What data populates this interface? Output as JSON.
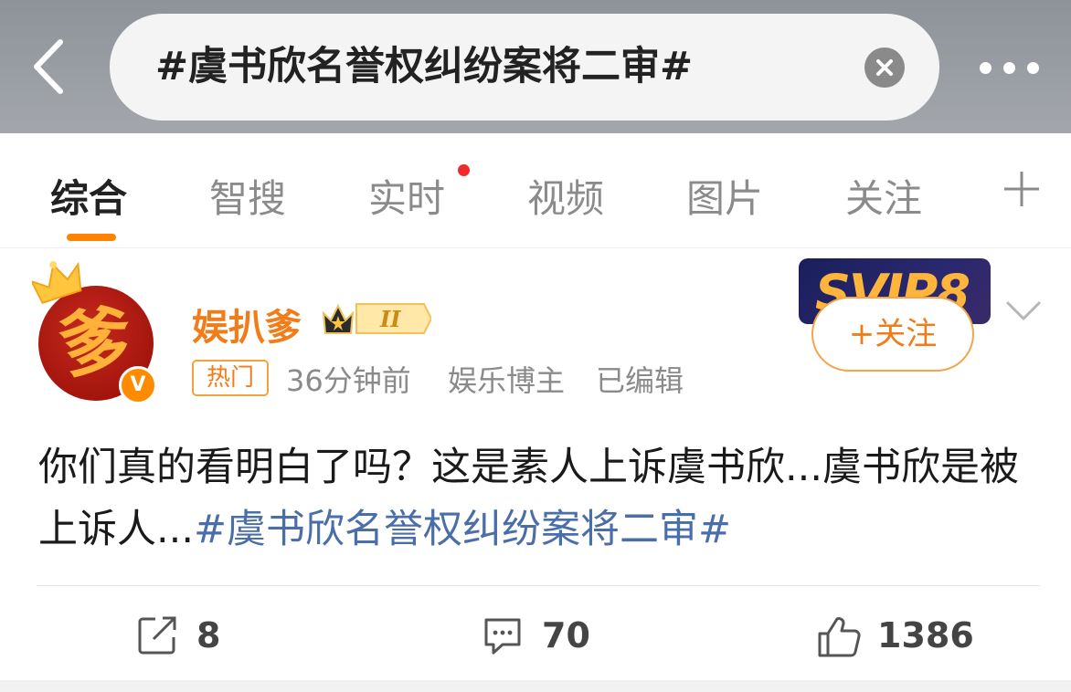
{
  "search": {
    "query": "#虞书欣名誉权纠纷案将二审#"
  },
  "tabs": [
    {
      "label": "综合",
      "active": true
    },
    {
      "label": "智搜",
      "active": false
    },
    {
      "label": "实时",
      "active": false,
      "has_dot": true
    },
    {
      "label": "视频",
      "active": false
    },
    {
      "label": "图片",
      "active": false
    },
    {
      "label": "关注",
      "active": false
    }
  ],
  "post": {
    "author": {
      "name": "娱扒爹",
      "avatar_char": "爹",
      "vip_level": "II",
      "verified_badge": "V"
    },
    "hot_badge": "热门",
    "time": "36分钟前",
    "role": "娱乐博主",
    "edited": "已编辑",
    "svip_label": "SVIP8",
    "follow_label": "+关注",
    "text_plain": "你们真的看明白了吗？这是素人上诉虞书欣...虞书欣是被上诉人...",
    "text_topic": "#虞书欣名誉权纠纷案将二审#",
    "actions": {
      "repost_count": "8",
      "comment_count": "70",
      "like_count": "1386"
    }
  },
  "colors": {
    "accent": "#ff8200",
    "username": "#f07c1a",
    "topic_link": "#4a6ea9",
    "topbar": "#9a9ea3"
  },
  "icons": [
    "back-icon",
    "clear-icon",
    "more-icon",
    "plus-icon",
    "crown-icon",
    "vip-crown-icon",
    "chevron-down-icon",
    "repost-icon",
    "comment-icon",
    "like-icon"
  ]
}
